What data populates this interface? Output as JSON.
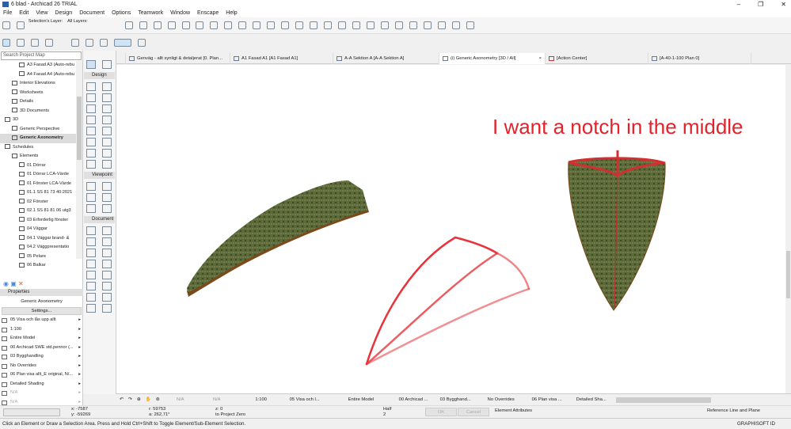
{
  "window": {
    "title": "6 blad - Archicad 26 TRIAL",
    "controls": [
      "–",
      "❐",
      "✕"
    ]
  },
  "menu": [
    "File",
    "Edit",
    "View",
    "Design",
    "Document",
    "Options",
    "Teamwork",
    "Window",
    "Enscape",
    "Help"
  ],
  "toolbar": {
    "selection_layer": "Selection's Layer:",
    "all_layers": "All Layers:"
  },
  "project_map": {
    "search_placeholder": "Search Project Map",
    "items": [
      {
        "label": "A3 Fasad A3 (Auto-rebu",
        "indent": 2
      },
      {
        "label": "A4 Fasad A4 (Auto-rebu",
        "indent": 2
      },
      {
        "label": "Interior Elevations",
        "indent": 1
      },
      {
        "label": "Worksheets",
        "indent": 1
      },
      {
        "label": "Details",
        "indent": 1
      },
      {
        "label": "3D Documents",
        "indent": 1
      },
      {
        "label": "3D",
        "indent": 0
      },
      {
        "label": "Generic Perspective",
        "indent": 1
      },
      {
        "label": "Generic Axonometry",
        "indent": 1,
        "selected": true
      },
      {
        "label": "Schedules",
        "indent": 0
      },
      {
        "label": "Elements",
        "indent": 1
      },
      {
        "label": "01 Dörrar",
        "indent": 2
      },
      {
        "label": "01 Dörrar LCA-Värde",
        "indent": 2
      },
      {
        "label": "01 Fönster LCA-Värde",
        "indent": 2
      },
      {
        "label": "01.1 SS 81 73 40:2021",
        "indent": 2
      },
      {
        "label": "02 Fönster",
        "indent": 2
      },
      {
        "label": "02.1 SS 81 81 06 utg3",
        "indent": 2
      },
      {
        "label": "03 Erforderlig fönster",
        "indent": 2
      },
      {
        "label": "04 Väggar",
        "indent": 2
      },
      {
        "label": "04.1 Väggar brand- &",
        "indent": 2
      },
      {
        "label": "04.2 Väggpresentatio",
        "indent": 2
      },
      {
        "label": "05 Pelare",
        "indent": 2
      },
      {
        "label": "06 Balkar",
        "indent": 2
      }
    ]
  },
  "properties": {
    "header": "Properties",
    "view_name": "Generic Axonometry",
    "settings_button": "Settings...",
    "rows": [
      "05 Visa och lås upp allt",
      "1:100",
      "Entire Model",
      "00 Archicad SWE std.pennor (...",
      "03 Bygghandling",
      "No Overrides",
      "06 Plan visa allt_E original, N/...",
      "Detailed Shading",
      "N/A",
      "N/A"
    ]
  },
  "toolbox": {
    "sections": [
      "Design",
      "Viewpoint",
      "Document"
    ]
  },
  "tabs": [
    {
      "label": "Genväg - allt synligt & detaljerat [0. Plan..."
    },
    {
      "label": "A1 Fasad A1 [A1 Fasad A1]"
    },
    {
      "label": "A-A Sektion A [A-A Sektion A]"
    },
    {
      "label": "(i) Generic Axonometry [3D / All]",
      "active": true
    },
    {
      "label": "[Action Center]"
    },
    {
      "label": "[A-40-1-100 Plan 0]"
    }
  ],
  "viewport": {
    "annotation": "I want a notch in the middle",
    "annotation_color": "#e3232b"
  },
  "bottom_bar": {
    "items": [
      "N/A",
      "N/A",
      "1:100",
      "05 Visa och l...",
      "Entire Model",
      "00 Archicad ...",
      "03 Bygghand...",
      "No Overrides",
      "06 Plan visa ...",
      "Detailed Sha..."
    ]
  },
  "coords": {
    "x": "x: -7587",
    "y": "y: -59269",
    "r": "r: 59753",
    "a": "a: 262,71°",
    "z": "z: 0",
    "ref": "to Project Zero",
    "half": "Half",
    "half_num": "2",
    "ok": "OK",
    "cancel": "Cancel",
    "element_attributes": "Element Attributes",
    "reference": "Reference Line and Plane"
  },
  "status": {
    "text": "Click an Element or Draw a Selection Area. Press and Hold Ctrl+Shift to Toggle Element/Sub-Element Selection.",
    "brand": "GRAPHISOFT ID"
  }
}
